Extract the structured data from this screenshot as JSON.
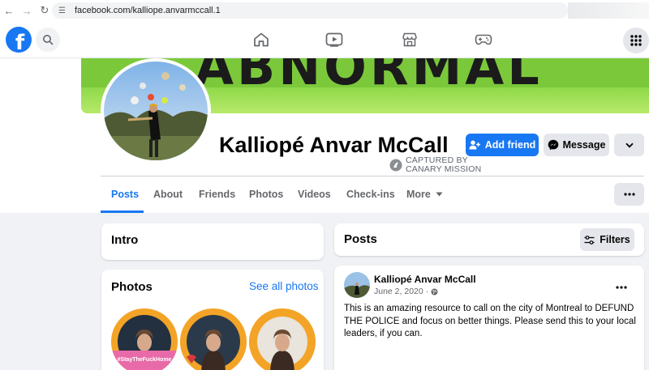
{
  "browser": {
    "url": "facebook.com/kalliope.anvarmccall.1"
  },
  "header": {
    "logo_letter": "f",
    "nav_icons": [
      "home-icon",
      "video-icon",
      "marketplace-icon",
      "gaming-icon"
    ]
  },
  "profile": {
    "name": "Kalliopé Anvar McCall",
    "watermark_line1": "CAPTURED BY",
    "watermark_line2": "CANARY MISSION",
    "add_friend_label": "Add friend",
    "message_label": "Message"
  },
  "tabs": [
    {
      "label": "Posts"
    },
    {
      "label": "About"
    },
    {
      "label": "Friends"
    },
    {
      "label": "Photos"
    },
    {
      "label": "Videos"
    },
    {
      "label": "Check-ins"
    },
    {
      "label": "More"
    }
  ],
  "intro": {
    "title": "Intro"
  },
  "photos_card": {
    "title": "Photos",
    "see_all": "See all photos",
    "thumb1_caption": "#StayTheFuckHome"
  },
  "posts_header": {
    "title": "Posts",
    "filters_label": "Filters"
  },
  "post": {
    "author": "Kalliopé Anvar McCall",
    "date": "June 2, 2020 ·",
    "body": "This is an amazing resource to call on the city of Montreal to DEFUND THE POLICE and focus on better things. Please send this to your local leaders, if you can."
  },
  "colors": {
    "brand": "#1877f2",
    "cover_green": "#7bc93b",
    "page_bg": "#f0f2f5"
  }
}
